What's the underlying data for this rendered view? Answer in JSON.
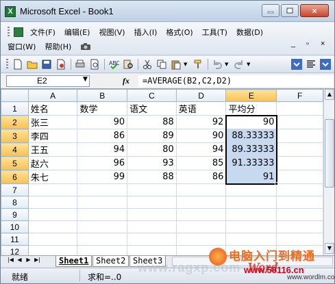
{
  "window": {
    "title": "Microsoft Excel - Book1",
    "close_glyph": "×"
  },
  "menu": {
    "row1": [
      "文件(F)",
      "编辑(E)",
      "视图(V)",
      "插入(I)",
      "格式(O)",
      "工具(T)",
      "数据(D)"
    ],
    "row2": [
      "窗口(W)",
      "帮助(H)"
    ],
    "ctrl_min": "_",
    "ctrl_restore": "▫",
    "ctrl_close": "×"
  },
  "formula_bar": {
    "name_box": "E2",
    "fx_label": "fx",
    "formula": "=AVERAGE(B2,C2,D2)"
  },
  "sheet": {
    "columns": [
      "A",
      "B",
      "C",
      "D",
      "E",
      "F"
    ],
    "rows": [
      {
        "n": "1",
        "cells": [
          "姓名",
          "数学",
          "语文",
          "英语",
          "平均分",
          ""
        ]
      },
      {
        "n": "2",
        "cells": [
          "张三",
          "90",
          "88",
          "92",
          "90",
          ""
        ]
      },
      {
        "n": "3",
        "cells": [
          "李四",
          "86",
          "89",
          "90",
          "88.33333",
          ""
        ]
      },
      {
        "n": "4",
        "cells": [
          "王五",
          "94",
          "80",
          "94",
          "89.33333",
          ""
        ]
      },
      {
        "n": "5",
        "cells": [
          "赵六",
          "96",
          "93",
          "85",
          "91.33333",
          ""
        ]
      },
      {
        "n": "6",
        "cells": [
          "朱七",
          "99",
          "88",
          "86",
          "91",
          ""
        ]
      },
      {
        "n": "7",
        "cells": [
          "",
          "",
          "",
          "",
          "",
          ""
        ]
      },
      {
        "n": "8",
        "cells": [
          "",
          "",
          "",
          "",
          "",
          ""
        ]
      },
      {
        "n": "9",
        "cells": [
          "",
          "",
          "",
          "",
          "",
          ""
        ]
      },
      {
        "n": "10",
        "cells": [
          "",
          "",
          "",
          "",
          "",
          ""
        ]
      },
      {
        "n": "11",
        "cells": [
          "",
          "",
          "",
          "",
          "",
          ""
        ]
      },
      {
        "n": "12",
        "cells": [
          "",
          "",
          "",
          "",
          "",
          ""
        ]
      }
    ],
    "tabs": [
      "Sheet1",
      "Sheet2",
      "Sheet3"
    ],
    "active_tab": "Sheet1"
  },
  "status": {
    "ready": "就绪",
    "sum": "求和=..0"
  },
  "watermark": {
    "center": "www.ragxp.com",
    "logo_cn": "电脑入门到精通",
    "logo_word": "Word",
    "logo_url": "www.58116.cn",
    "logo_url2": "www.wordlm.com"
  },
  "colors": {
    "selection": "#c5d9f1",
    "active_header": "#f8c051",
    "logo_orange": "#f26a1b"
  }
}
